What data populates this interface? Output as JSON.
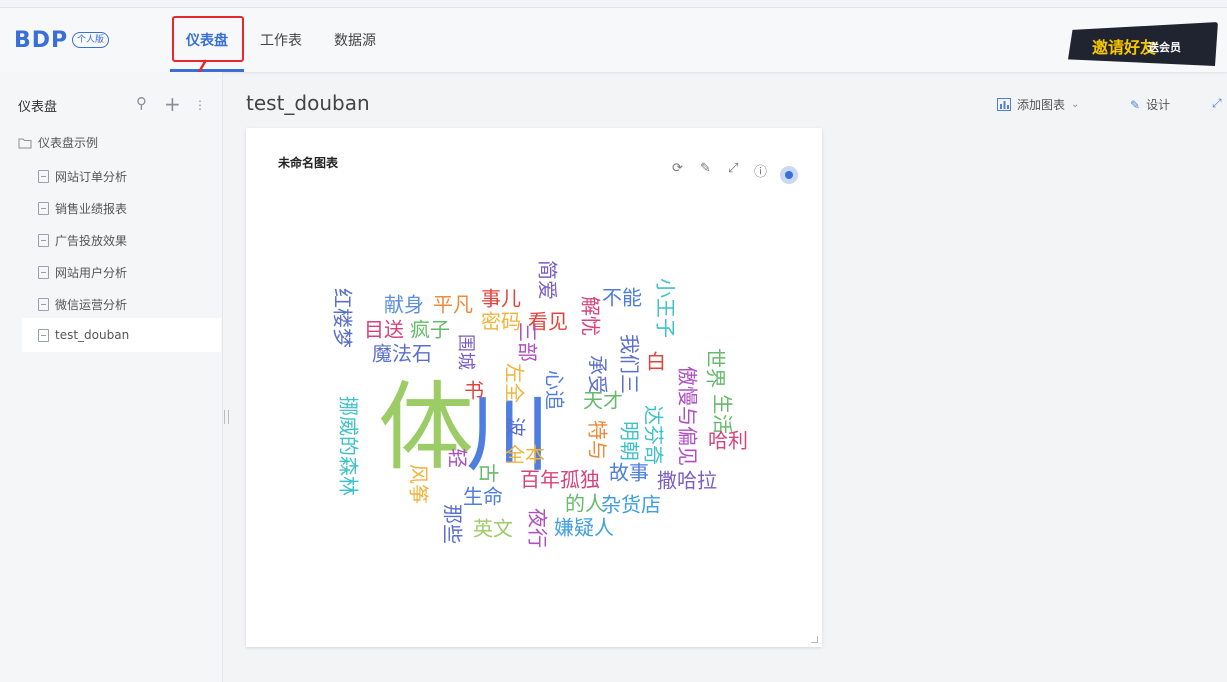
{
  "app": {
    "logo": "BDP",
    "edition": "个人版"
  },
  "nav": {
    "tabs": [
      "仪表盘",
      "工作表",
      "数据源"
    ],
    "active": 0
  },
  "promo": {
    "text": "邀请好友",
    "sub": "送会员"
  },
  "sidebar": {
    "title": "仪表盘",
    "folder": "仪表盘示例",
    "items": [
      "网站订单分析",
      "销售业绩报表",
      "广告投放效果",
      "网站用户分析",
      "微信运营分析"
    ],
    "selected_item": "test_douban"
  },
  "dashboard": {
    "title": "test_douban",
    "add_chart": "添加图表",
    "design": "设计"
  },
  "chart_card": {
    "title": "未命名图表"
  },
  "chart_data": {
    "type": "wordcloud",
    "words": [
      {
        "text": "体",
        "color": "#9ccc65"
      },
      {
        "text": "川",
        "color": "#4f7ee0"
      },
      {
        "text": "红楼梦",
        "color": "#5b6fce"
      },
      {
        "text": "献身",
        "color": "#5b8fe0"
      },
      {
        "text": "平凡",
        "color": "#ef8a3b"
      },
      {
        "text": "事儿",
        "color": "#e0443d"
      },
      {
        "text": "简爱",
        "color": "#7a5cc4"
      },
      {
        "text": "解忧",
        "color": "#d6437a"
      },
      {
        "text": "不能",
        "color": "#4f7ee0"
      },
      {
        "text": "小王子",
        "color": "#3fc1c9"
      },
      {
        "text": "目送",
        "color": "#d6437a"
      },
      {
        "text": "疯子",
        "color": "#66bb6a"
      },
      {
        "text": "密码",
        "color": "#f0b43b"
      },
      {
        "text": "看见",
        "color": "#e0443d"
      },
      {
        "text": "魔法石",
        "color": "#5b6fce"
      },
      {
        "text": "围城",
        "color": "#7a5cc4"
      },
      {
        "text": "三部",
        "color": "#b04fc4"
      },
      {
        "text": "我们三",
        "color": "#5b6fce"
      },
      {
        "text": "白",
        "color": "#e0443d"
      },
      {
        "text": "世界",
        "color": "#66bb6a"
      },
      {
        "text": "挪威的森林",
        "color": "#3fc1c9"
      },
      {
        "text": "左全",
        "color": "#f0b43b"
      },
      {
        "text": "心追",
        "color": "#4f7ee0"
      },
      {
        "text": "承受",
        "color": "#5b6fce"
      },
      {
        "text": "天才",
        "color": "#66bb6a"
      },
      {
        "text": "傲慢与偏见",
        "color": "#b04fc4"
      },
      {
        "text": "生活",
        "color": "#66bb6a"
      },
      {
        "text": "哈利",
        "color": "#d6437a"
      },
      {
        "text": "书",
        "color": "#e0443d"
      },
      {
        "text": "波",
        "color": "#5b6fce"
      },
      {
        "text": "特与",
        "color": "#ef8a3b"
      },
      {
        "text": "明朝",
        "color": "#3fc1c9"
      },
      {
        "text": "达芬奇",
        "color": "#3fc1c9"
      },
      {
        "text": "全本",
        "color": "#f0b43b"
      },
      {
        "text": "风筝",
        "color": "#f0b43b"
      },
      {
        "text": "轻",
        "color": "#b04fc4"
      },
      {
        "text": "古",
        "color": "#66bb6a"
      },
      {
        "text": "百年孤独",
        "color": "#d6437a"
      },
      {
        "text": "故事",
        "color": "#4f7ee0"
      },
      {
        "text": "撒哈拉",
        "color": "#7a5cc4"
      },
      {
        "text": "那些",
        "color": "#5b6fce"
      },
      {
        "text": "生命",
        "color": "#4f7ee0"
      },
      {
        "text": "夜行",
        "color": "#b04fc4"
      },
      {
        "text": "的人",
        "color": "#66bb6a"
      },
      {
        "text": "杂货店",
        "color": "#3f9fe0"
      },
      {
        "text": "英文",
        "color": "#9ccc65"
      },
      {
        "text": "嫌疑人",
        "color": "#3f9fe0"
      }
    ]
  }
}
